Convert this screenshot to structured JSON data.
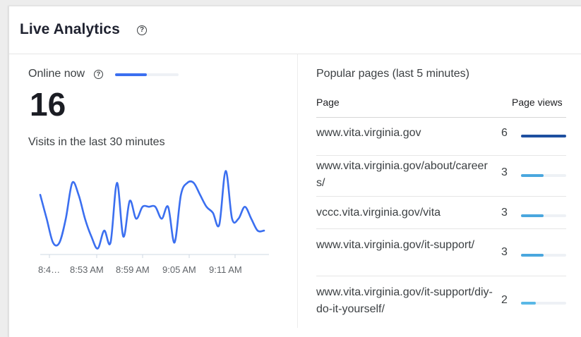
{
  "header": {
    "title": "Live Analytics",
    "help_icon": "help-circle-icon"
  },
  "online": {
    "label": "Online now",
    "count": "16",
    "bar_fraction": 0.5,
    "bar_color": "#3b6ff0"
  },
  "visits": {
    "label": "Visits in the last 30 minutes"
  },
  "chart_data": {
    "type": "line",
    "x_tick_labels": [
      "8:4…",
      "8:53 AM",
      "8:59 AM",
      "9:05 AM",
      "9:11 AM"
    ],
    "values": [
      5,
      3,
      1,
      1,
      3,
      6,
      5,
      3,
      1.5,
      0.5,
      2,
      1,
      6,
      1.5,
      4.5,
      3,
      4,
      4,
      4,
      3,
      4,
      1,
      5,
      6,
      6,
      5,
      4,
      3.5,
      2.5,
      7,
      3,
      3,
      4,
      3,
      2,
      2
    ],
    "ylim": [
      0,
      7.5
    ],
    "grid": false,
    "line_color": "#3b6ff0"
  },
  "popular": {
    "title": "Popular pages (last 5 minutes)",
    "col_page": "Page",
    "col_views": "Page views",
    "max_views": 6,
    "rows": [
      {
        "url": "www.vita.virginia.gov",
        "views": "6",
        "views_value": 6,
        "bar_color": "#1e4fa0"
      },
      {
        "url": "www.vita.virginia.gov/about/careers/",
        "views": "3",
        "views_value": 3,
        "bar_color": "#4aa7de"
      },
      {
        "url": "vccc.vita.virginia.gov/vita",
        "views": "3",
        "views_value": 3,
        "bar_color": "#4aa7de"
      },
      {
        "url": "www.vita.virginia.gov/it-support/",
        "views": "3",
        "views_value": 3,
        "bar_color": "#4aa7de"
      },
      {
        "url": "www.vita.virginia.gov/it-support/diy-do-it-yourself/",
        "views": "2",
        "views_value": 2,
        "bar_color": "#5ab8e6"
      }
    ]
  }
}
